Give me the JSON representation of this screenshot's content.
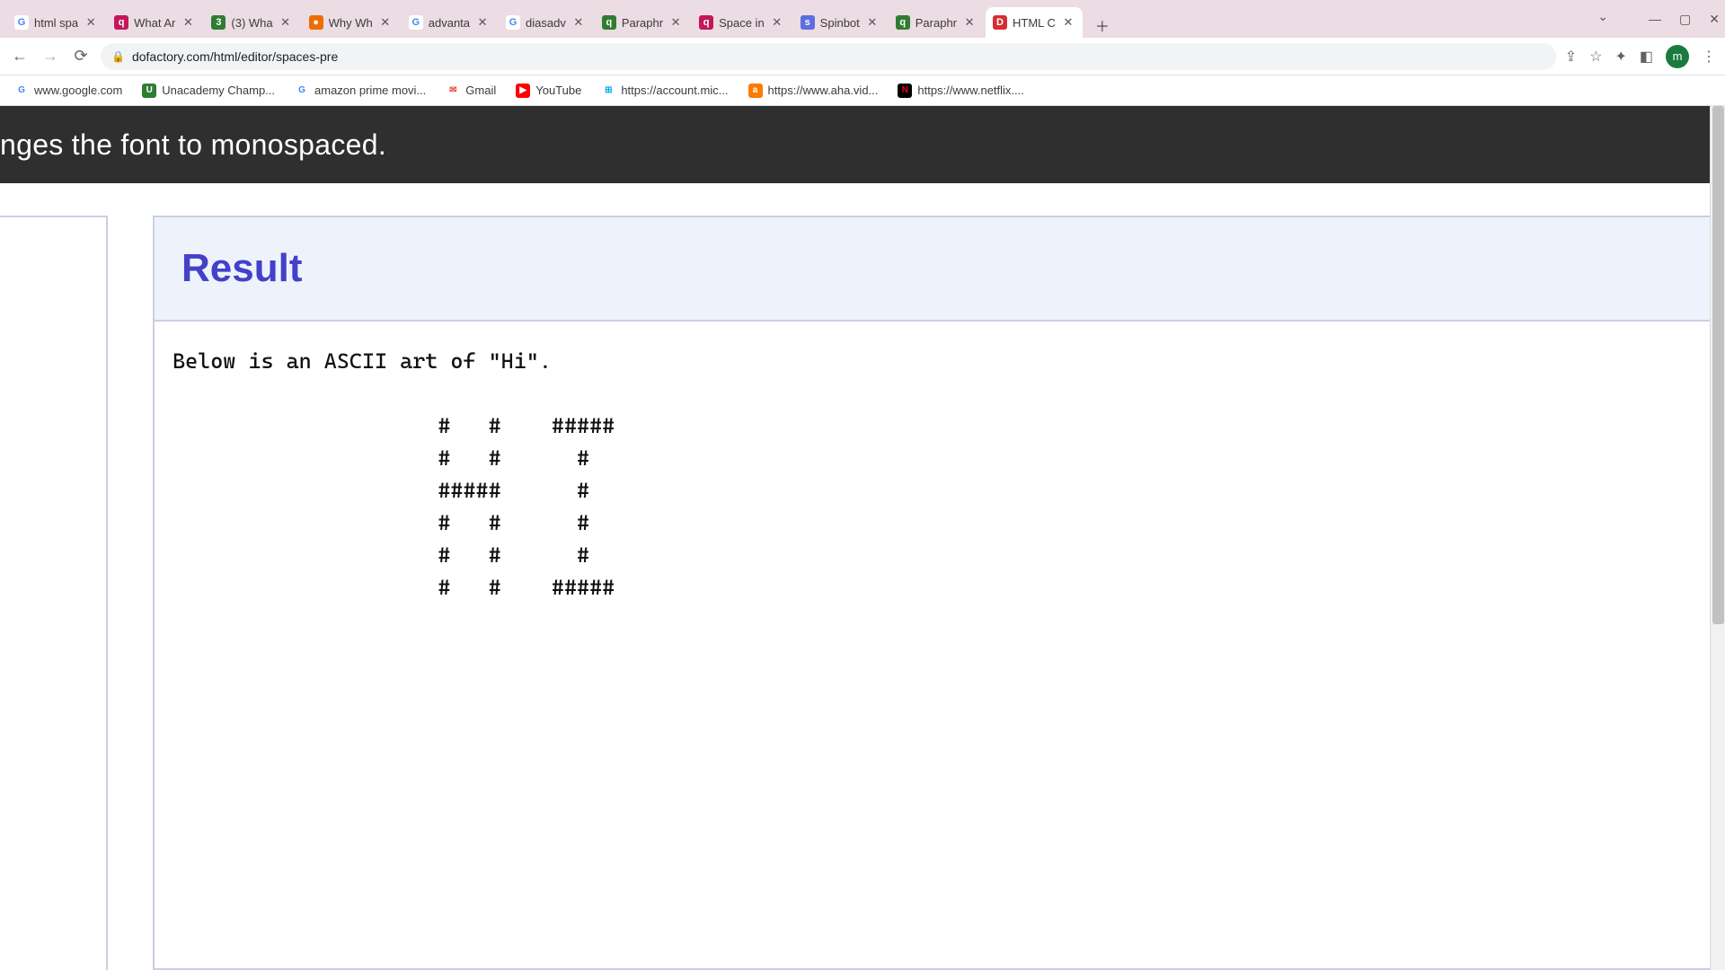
{
  "tabs": [
    {
      "title": "html spa",
      "fav_bg": "#ffffff",
      "fav_txt": "G",
      "fav_color": "#4285f4"
    },
    {
      "title": "What Ar",
      "fav_bg": "#c2185b",
      "fav_txt": "q",
      "fav_color": "#ffffff"
    },
    {
      "title": "(3) Wha",
      "fav_bg": "#2e7d32",
      "fav_txt": "3",
      "fav_color": "#ffffff"
    },
    {
      "title": "Why Wh",
      "fav_bg": "#ef6c00",
      "fav_txt": "●",
      "fav_color": "#ffffff"
    },
    {
      "title": "advanta",
      "fav_bg": "#ffffff",
      "fav_txt": "G",
      "fav_color": "#4285f4"
    },
    {
      "title": "diasadv",
      "fav_bg": "#ffffff",
      "fav_txt": "G",
      "fav_color": "#4285f4"
    },
    {
      "title": "Paraphr",
      "fav_bg": "#2e7d32",
      "fav_txt": "q",
      "fav_color": "#ffffff"
    },
    {
      "title": "Space in",
      "fav_bg": "#c2185b",
      "fav_txt": "q",
      "fav_color": "#ffffff"
    },
    {
      "title": "Spinbot",
      "fav_bg": "#5b6ee1",
      "fav_txt": "s",
      "fav_color": "#ffffff"
    },
    {
      "title": "Paraphr",
      "fav_bg": "#2e7d32",
      "fav_txt": "q",
      "fav_color": "#ffffff"
    },
    {
      "title": "HTML C",
      "fav_bg": "#d32f2f",
      "fav_txt": "D",
      "fav_color": "#ffffff"
    }
  ],
  "active_tab_index": 10,
  "url": "dofactory.com/html/editor/spaces-pre",
  "avatar_initial": "m",
  "bookmarks": [
    {
      "label": "www.google.com",
      "fav_bg": "#ffffff",
      "fav_txt": "G",
      "fav_color": "#4285f4"
    },
    {
      "label": "Unacademy Champ...",
      "fav_bg": "#2e7d32",
      "fav_txt": "U",
      "fav_color": "#ffffff"
    },
    {
      "label": "amazon prime movi...",
      "fav_bg": "#ffffff",
      "fav_txt": "G",
      "fav_color": "#4285f4"
    },
    {
      "label": "Gmail",
      "fav_bg": "#ffffff",
      "fav_txt": "✉",
      "fav_color": "#ea4335"
    },
    {
      "label": "YouTube",
      "fav_bg": "#ff0000",
      "fav_txt": "▶",
      "fav_color": "#ffffff"
    },
    {
      "label": "https://account.mic...",
      "fav_bg": "#ffffff",
      "fav_txt": "⊞",
      "fav_color": "#00a4ef"
    },
    {
      "label": "https://www.aha.vid...",
      "fav_bg": "#ff7a00",
      "fav_txt": "a",
      "fav_color": "#ffffff"
    },
    {
      "label": "https://www.netflix....",
      "fav_bg": "#000000",
      "fav_txt": "N",
      "fav_color": "#e50914"
    }
  ],
  "banner_text": "nges the font to monospaced.",
  "result_heading": "Result",
  "pre_text": "Below is an ASCII art of \"Hi\".\n\n                     #   #    #####\n                     #   #      #\n                     #####      #\n                     #   #      #\n                     #   #      #\n                     #   #    #####"
}
